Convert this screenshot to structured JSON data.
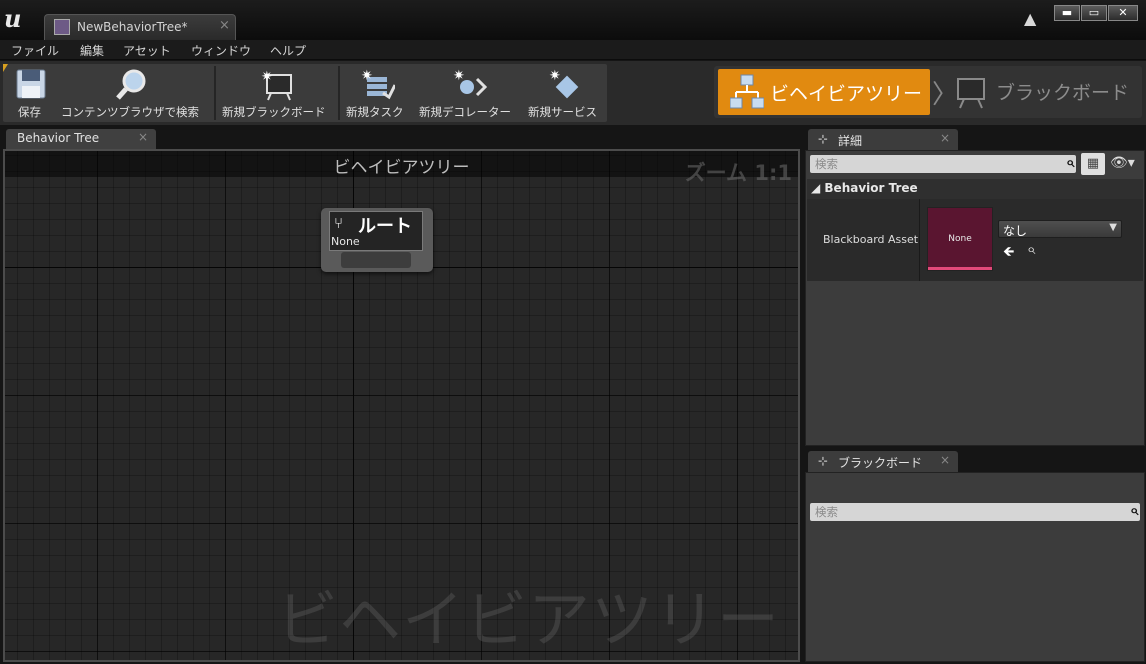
{
  "window": {
    "tab_title": "NewBehaviorTree*",
    "tab_close": "×",
    "min_glyph": "▬",
    "max_glyph": "▭",
    "close_glyph": "✕"
  },
  "menu": [
    "ファイル",
    "編集",
    "アセット",
    "ウィンドウ",
    "ヘルプ"
  ],
  "toolbar": {
    "items": [
      {
        "label": "保存",
        "icon": "save-icon"
      },
      {
        "label": "コンテンツブラウザで検索",
        "icon": "find-in-browser-icon"
      },
      {
        "label": "新規ブラックボード",
        "icon": "new-blackboard-icon"
      },
      {
        "label": "新規タスク",
        "icon": "new-task-icon"
      },
      {
        "label": "新規デコレーター",
        "icon": "new-decorator-icon"
      },
      {
        "label": "新規サービス",
        "icon": "new-service-icon"
      }
    ]
  },
  "modes": {
    "behavior_tree": "ビヘイビアツリー",
    "separator": "〉",
    "blackboard": "ブラックボード",
    "active_color": "#e18a10"
  },
  "graph": {
    "tab_label": "Behavior Tree",
    "tab_close": "×",
    "title": "ビヘイビアツリー",
    "zoom": "ズーム 1:1",
    "watermark": "ビヘイビアツリー",
    "root_node": {
      "title": "ルート",
      "subtitle": "None"
    }
  },
  "details": {
    "tab_label": "詳細",
    "tab_close": "×",
    "search_placeholder": "検索",
    "section": "Behavior Tree",
    "property_name": "Blackboard Asset",
    "thumbnail_text": "None",
    "combo_value": "なし"
  },
  "blackboard_panel": {
    "tab_label": "ブラックボード",
    "tab_close": "×",
    "search_placeholder": "検索"
  }
}
